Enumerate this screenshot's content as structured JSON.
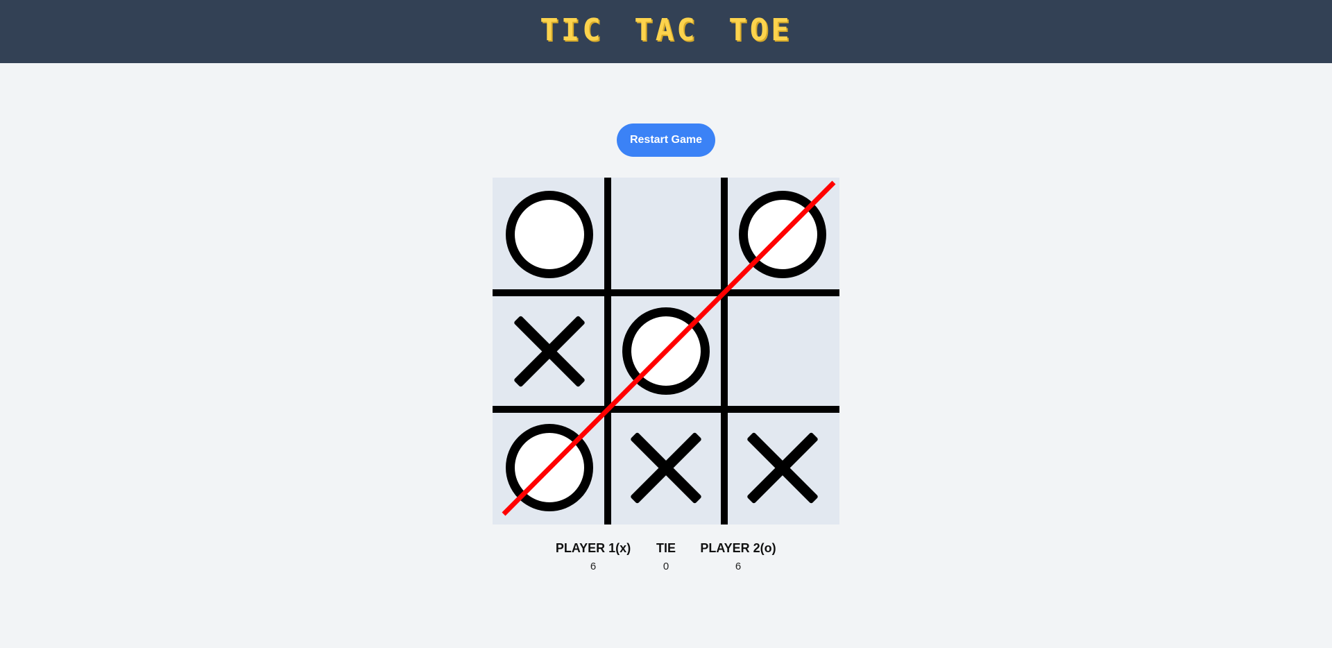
{
  "header": {
    "title": "TIC TAC TOE",
    "background": "#334155",
    "title_color": "#fcd34d"
  },
  "controls": {
    "restart_label": "Restart Game",
    "button_color": "#3b82f6"
  },
  "board": {
    "cells": [
      "O",
      "",
      "O",
      "X",
      "O",
      "",
      "O",
      "X",
      "X"
    ],
    "winning_line": [
      6,
      4,
      2
    ],
    "winning_line_color": "#ff0000",
    "cell_color": "#e2e8f0"
  },
  "scores": {
    "player1": {
      "label": "PLAYER 1(x)",
      "value": "6"
    },
    "tie": {
      "label": "TIE",
      "value": "0"
    },
    "player2": {
      "label": "PLAYER 2(o)",
      "value": "6"
    }
  }
}
